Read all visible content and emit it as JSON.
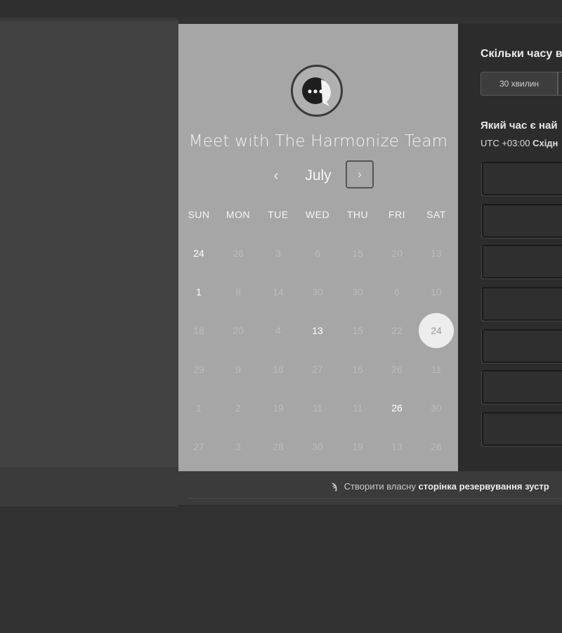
{
  "scheduler": {
    "title": "Meet with The Harmonize Team",
    "month": "July",
    "prev_icon": "chevron-left-icon",
    "next_icon": "chevron-right-icon",
    "weekdays": [
      "SUN",
      "MON",
      "TUE",
      "WED",
      "THU",
      "FRI",
      "SAT"
    ],
    "weeks": [
      [
        "24",
        "26",
        "3",
        "6",
        "15",
        "20",
        "13"
      ],
      [
        "1",
        "8",
        "14",
        "30",
        "30",
        "6",
        "10"
      ],
      [
        "18",
        "20",
        "4",
        "13",
        "15",
        "22",
        "24"
      ],
      [
        "29",
        "9",
        "18",
        "27",
        "15",
        "26",
        "11"
      ],
      [
        "1",
        "2",
        "19",
        "11",
        "11",
        "26",
        "30"
      ],
      [
        "27",
        "3",
        "28",
        "30",
        "19",
        "13",
        "26"
      ]
    ],
    "selected_day": "24"
  },
  "details": {
    "duration_heading": "Скільки часу в",
    "duration_option": "30 хвилин",
    "time_heading": "Який час є най",
    "timezone_prefix": "UTC +03:00",
    "timezone_name": "Східн"
  },
  "footer": {
    "text_prefix": "Створити власну",
    "text_link": "сторінка резервування зустр",
    "icon": "sprocket-icon"
  },
  "colors": {
    "calendar_bg": "#a6a6a6",
    "selected_day_bg": "#ededed",
    "right_panel_bg": "#2c2c2c"
  }
}
